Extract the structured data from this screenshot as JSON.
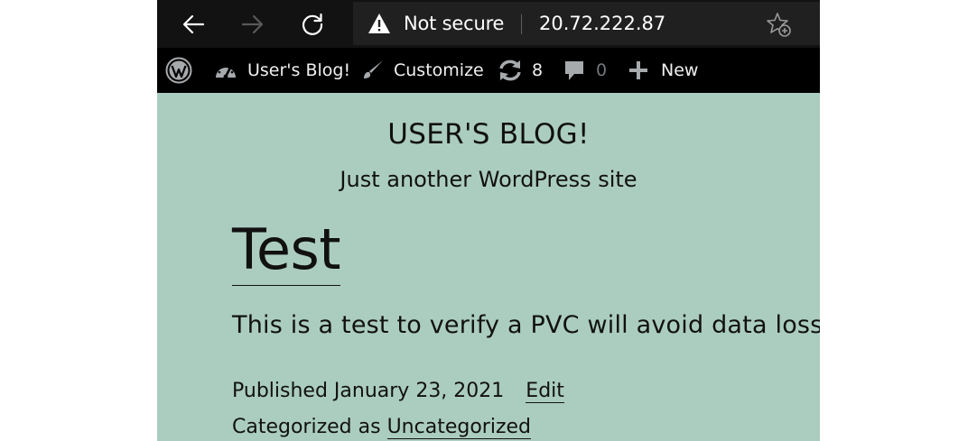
{
  "browser": {
    "security_label": "Not secure",
    "url": "20.72.222.87"
  },
  "admin_bar": {
    "site_name": "User's Blog!",
    "customize": "Customize",
    "updates_count": "8",
    "comments_count": "0",
    "new_label": "New"
  },
  "site": {
    "title": "USER'S BLOG!",
    "description": "Just another WordPress site"
  },
  "post": {
    "title": "Test",
    "excerpt": "This is a test to verify a PVC will avoid data loss.",
    "published_prefix": "Published",
    "published_date": "January 23, 2021",
    "edit_label": "Edit",
    "categorized_prefix": "Categorized as",
    "category": "Uncategorized"
  },
  "colors": {
    "page_background": "#abcdbf",
    "browser_toolbar": "#121212",
    "admin_bar": "#000000"
  },
  "icons": [
    "back-arrow-icon",
    "forward-arrow-icon",
    "reload-icon",
    "warning-icon",
    "star-add-icon",
    "wordpress-logo-icon",
    "dashboard-icon",
    "brush-icon",
    "updates-icon",
    "comment-icon",
    "plus-icon"
  ]
}
